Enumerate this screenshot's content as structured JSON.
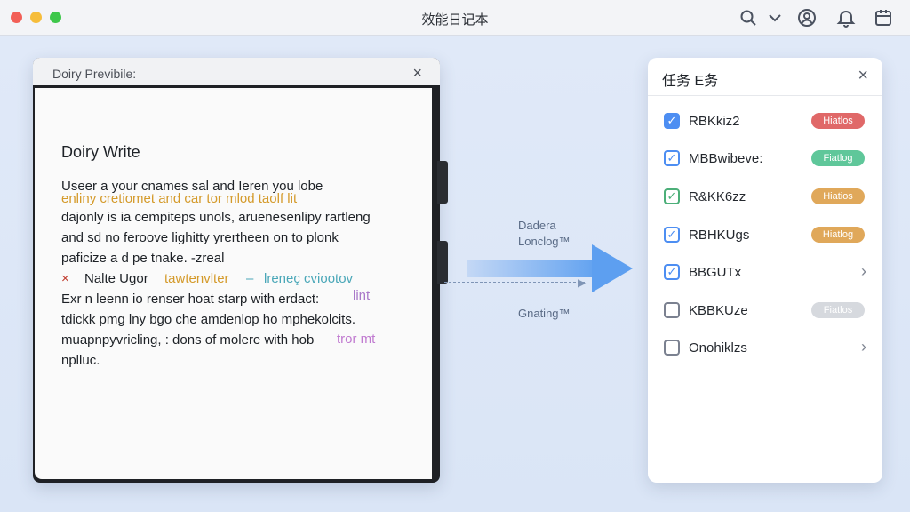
{
  "window": {
    "title": "效能日记本"
  },
  "toolbar": {
    "icons": [
      "search-icon",
      "chevron-down-icon",
      "account-icon",
      "bell-icon",
      "calendar-icon"
    ]
  },
  "editor": {
    "header_title": "Doiry Previbile:",
    "close_label": "×",
    "doc_title": "Doiry Write",
    "lines": [
      "Useer a your cnames sal and Ieren you lobe",
      "dajonly is ia cempiteps unols, aruenesenlipy rartleng",
      "and sd no feroove lighitty yrertheen on to plonk",
      "paficize a d pe tnake.  ‐zreal",
      "Exr n leenn io renser hoat starp with erdact:",
      "tdickk pmg lny bgo che amdenlop ho mphekolcits.",
      "muapnpyvricling, : dons of molere with hob",
      "nplluc."
    ],
    "annotations": {
      "orange_line": "enliny cretiomet and car tor mlod taolf  lit",
      "bullet_marker": "×",
      "bullet_text": "Nalte Ugor",
      "orange_inline": "tawtenvlter",
      "dash": "–",
      "teal_inline": "lreneç  cviootov",
      "purple_tail_1": "lint",
      "purple_tail_2": "tror mt"
    }
  },
  "flow": {
    "label_top_line1": "Dadera",
    "label_top_line2": "Lonclog™",
    "label_bottom": "Gnating™"
  },
  "tasks_panel": {
    "title": "任务 E务",
    "close_label": "×",
    "items": [
      {
        "label": "RBKkiz2",
        "state": "checked",
        "badge": "Hiatlos",
        "badge_color": "#e06868"
      },
      {
        "label": "MBBwibeve:",
        "state": "checked-outline-blue",
        "badge": "Fiatlog",
        "badge_color": "#5fc79a"
      },
      {
        "label": "R&KK6zz",
        "state": "checked-outline-green",
        "badge": "Hiatios",
        "badge_color": "#e0a85a"
      },
      {
        "label": "RBHKUgs",
        "state": "checked-outline-blue",
        "badge": "Hiatlog",
        "badge_color": "#e0a85a"
      },
      {
        "label": "BBGUTx",
        "state": "checked-outline-blue",
        "badge": "",
        "chevron": "›"
      },
      {
        "label": "KBBKUze",
        "state": "unchecked",
        "badge": "Fiatlos",
        "badge_color": "#d6d9de"
      },
      {
        "label": "Onohiklzs",
        "state": "unchecked",
        "badge": "",
        "chevron": "›"
      }
    ]
  }
}
